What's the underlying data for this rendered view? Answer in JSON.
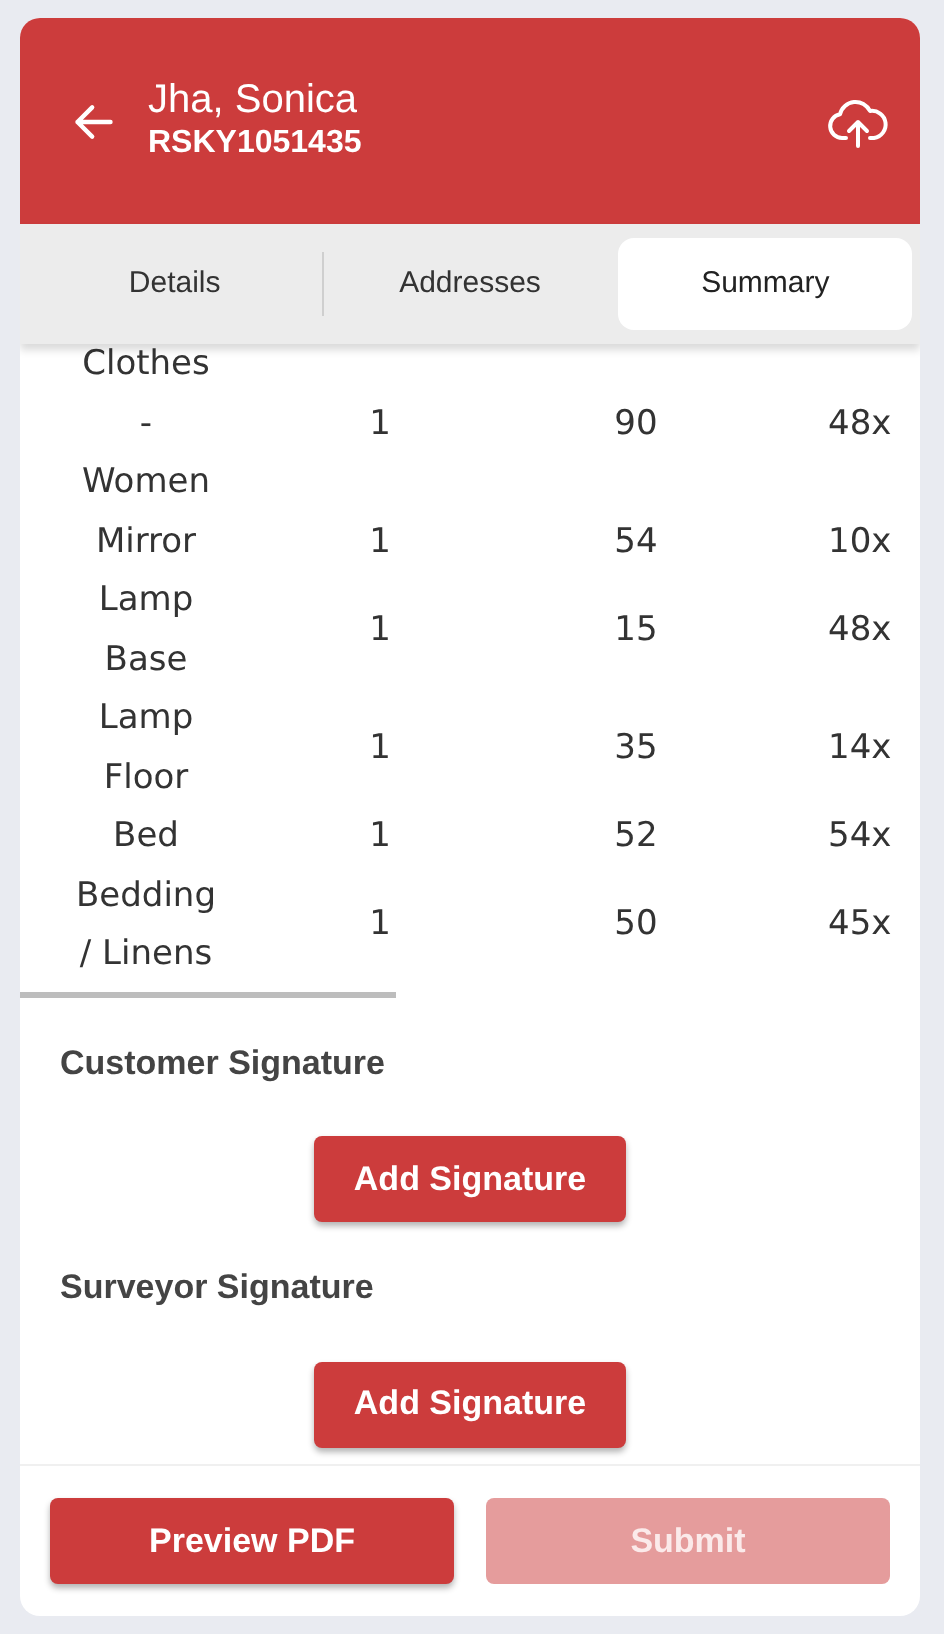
{
  "header": {
    "title": "Jha, Sonica",
    "subtitle": "RSKY1051435"
  },
  "tabs": [
    {
      "label": "Details",
      "selected": false
    },
    {
      "label": "Addresses",
      "selected": false
    },
    {
      "label": "Summary",
      "selected": true
    }
  ],
  "table": {
    "rows": [
      {
        "column_1": "Clothes - Women",
        "column_2": "1",
        "column_3": "90",
        "column_4": "48x"
      },
      {
        "column_1": "Mirror",
        "column_2": "1",
        "column_3": "54",
        "column_4": "10x"
      },
      {
        "column_1": "Lamp Base",
        "column_2": "1",
        "column_3": "15",
        "column_4": "48x"
      },
      {
        "column_1": "Lamp Floor",
        "column_2": "1",
        "column_3": "35",
        "column_4": "14x"
      },
      {
        "column_1": "Bed",
        "column_2": "1",
        "column_3": "52",
        "column_4": "54x"
      },
      {
        "column_1": "Bedding / Linens",
        "column_2": "1",
        "column_3": "50",
        "column_4": "45x"
      }
    ]
  },
  "signatures": [
    {
      "label": "Customer Signature",
      "button": "Add Signature"
    },
    {
      "label": "Surveyor Signature",
      "button": "Add Signature"
    }
  ],
  "footer_buttons": [
    {
      "label": "Preview PDF",
      "disabled": false
    },
    {
      "label": "Submit",
      "disabled": true
    }
  ]
}
